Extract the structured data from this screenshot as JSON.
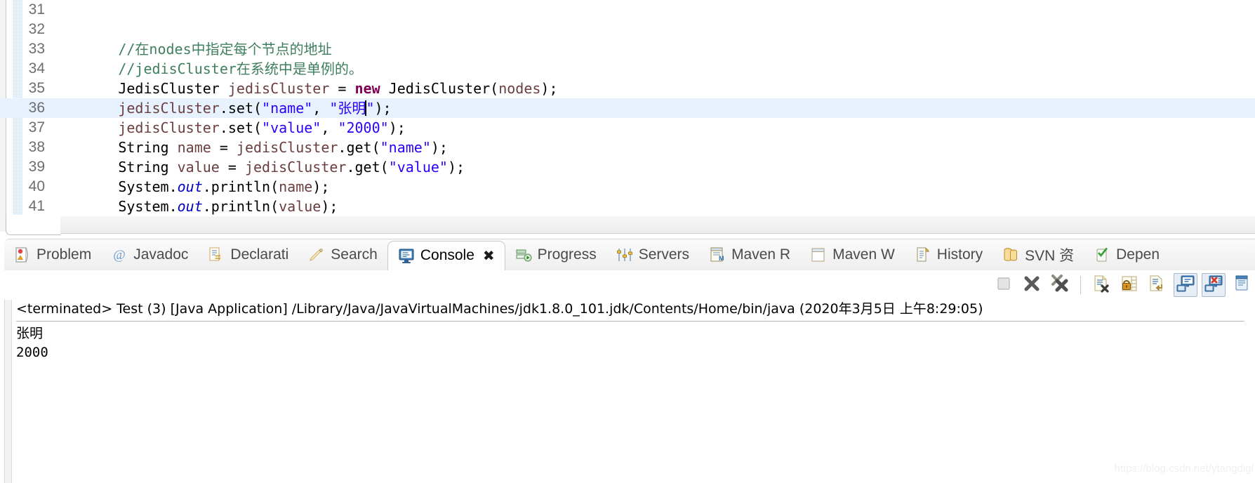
{
  "editor": {
    "first_line_number": 31,
    "highlighted_line": 36,
    "lines": [
      {
        "num": 31,
        "text": ""
      },
      {
        "num": 32,
        "text": ""
      },
      {
        "num": 33,
        "text": "        //在nodes中指定每个节点的地址"
      },
      {
        "num": 34,
        "text": "        //jedisCluster在系统中是单例的。"
      },
      {
        "num": 35,
        "text": "        JedisCluster jedisCluster = new JedisCluster(nodes);"
      },
      {
        "num": 36,
        "text": "        jedisCluster.set(\"name\", \"张明\");"
      },
      {
        "num": 37,
        "text": "        jedisCluster.set(\"value\", \"2000\");"
      },
      {
        "num": 38,
        "text": "        String name = jedisCluster.get(\"name\");"
      },
      {
        "num": 39,
        "text": "        String value = jedisCluster.get(\"value\");"
      },
      {
        "num": 40,
        "text": "        System.out.println(name);"
      },
      {
        "num": 41,
        "text": "        System.out.println(value);"
      }
    ],
    "colors": {
      "comment": "#3f7f5f",
      "keyword": "#7f0055",
      "string": "#2a00ff",
      "field": "#0000c0",
      "local_var": "#6a3e3e",
      "line_highlight": "#e8f2fe",
      "change_bar": "#cfe3f7"
    }
  },
  "view": {
    "tabs": [
      {
        "label": "Problem",
        "icon": "problems-icon",
        "active": false
      },
      {
        "label": "Javadoc",
        "icon": "javadoc-at-icon",
        "active": false
      },
      {
        "label": "Declarati",
        "icon": "declaration-icon",
        "active": false
      },
      {
        "label": "Search",
        "icon": "search-pencil-icon",
        "active": false
      },
      {
        "label": "Console",
        "icon": "console-monitor-icon",
        "active": true,
        "close_glyph": "✖"
      },
      {
        "label": "Progress",
        "icon": "progress-icon",
        "active": false
      },
      {
        "label": "Servers",
        "icon": "servers-icon",
        "active": false
      },
      {
        "label": "Maven R",
        "icon": "maven-repositories-icon",
        "active": false
      },
      {
        "label": "Maven W",
        "icon": "maven-workspace-icon",
        "active": false
      },
      {
        "label": "History",
        "icon": "history-icon",
        "active": false
      },
      {
        "label": "SVN 资",
        "icon": "svn-repository-icon",
        "active": false
      },
      {
        "label": "Depen",
        "icon": "dependencies-icon",
        "active": false
      }
    ],
    "toolbar": [
      {
        "name": "terminate-button",
        "icon": "stop-square-icon",
        "pressed": false,
        "enabled": false
      },
      {
        "name": "remove-launch-button",
        "icon": "x-icon",
        "pressed": false,
        "enabled": true
      },
      {
        "name": "remove-all-terminated-button",
        "icon": "double-x-icon",
        "pressed": false,
        "enabled": true
      },
      {
        "name": "separator-1",
        "icon": "separator",
        "pressed": false,
        "enabled": true
      },
      {
        "name": "clear-console-button",
        "icon": "clear-console-icon",
        "pressed": false,
        "enabled": true
      },
      {
        "name": "scroll-lock-button",
        "icon": "scroll-lock-icon",
        "pressed": false,
        "enabled": true
      },
      {
        "name": "word-wrap-button",
        "icon": "word-wrap-icon",
        "pressed": false,
        "enabled": true
      },
      {
        "name": "pin-console-button",
        "icon": "display-selected-console-icon",
        "pressed": true,
        "enabled": true
      },
      {
        "name": "close-console-button",
        "icon": "close-console-icon",
        "pressed": true,
        "enabled": true
      },
      {
        "name": "open-console-button",
        "icon": "open-console-icon",
        "pressed": false,
        "enabled": true
      }
    ]
  },
  "console": {
    "header": "<terminated> Test (3) [Java Application] /Library/Java/JavaVirtualMachines/jdk1.8.0_101.jdk/Contents/Home/bin/java (2020年3月5日 上午8:29:05)",
    "output": [
      "张明",
      "2000"
    ]
  },
  "watermark": {
    "text": "https://blog.csdn.net/ytangdigl"
  }
}
